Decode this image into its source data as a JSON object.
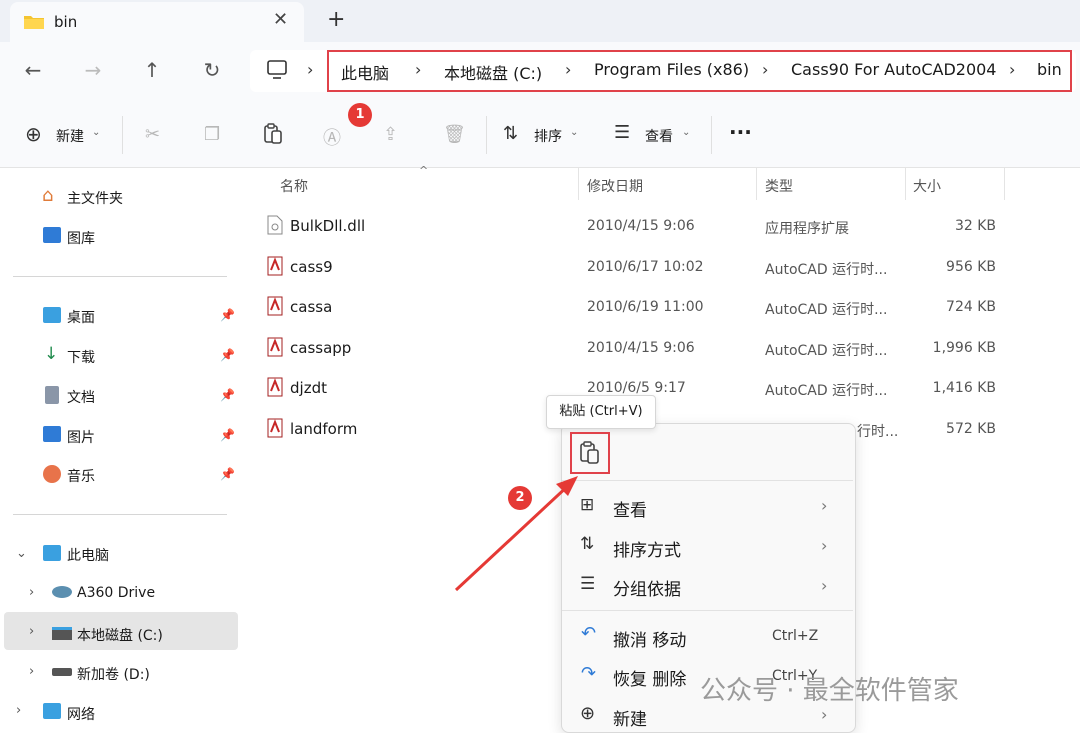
{
  "tab": {
    "title": "bin",
    "close_icon": "close-icon",
    "new_tab_icon": "plus-icon"
  },
  "nav": {
    "back": "back-arrow-icon",
    "forward": "forward-arrow-icon",
    "up": "up-arrow-icon",
    "refresh": "refresh-icon",
    "computer": "computer-icon"
  },
  "breadcrumbs": [
    "此电脑",
    "本地磁盘 (C:)",
    "Program Files (x86)",
    "Cass90 For AutoCAD2004",
    "bin"
  ],
  "toolbar": {
    "new_label": "新建",
    "sort_label": "排序",
    "view_label": "查看",
    "more": "···"
  },
  "annotations": {
    "badge1": "1",
    "badge2": "2",
    "highlight_color": "#e0424a"
  },
  "sidebar": {
    "home": "主文件夹",
    "gallery": "图库",
    "quick": [
      {
        "label": "桌面"
      },
      {
        "label": "下载"
      },
      {
        "label": "文档"
      },
      {
        "label": "图片"
      },
      {
        "label": "音乐"
      }
    ],
    "this_pc": "此电脑",
    "drives": [
      {
        "label": "A360 Drive"
      },
      {
        "label": "本地磁盘 (C:)"
      },
      {
        "label": "新加卷 (D:)"
      }
    ],
    "network": "网络"
  },
  "columns": {
    "name": "名称",
    "date": "修改日期",
    "type": "类型",
    "size": "大小"
  },
  "files": [
    {
      "name": "BulkDll.dll",
      "date": "2010/4/15 9:06",
      "type": "应用程序扩展",
      "size": "32 KB"
    },
    {
      "name": "cass9",
      "date": "2010/6/17 10:02",
      "type": "AutoCAD 运行时...",
      "size": "956 KB"
    },
    {
      "name": "cassa",
      "date": "2010/6/19 11:00",
      "type": "AutoCAD 运行时...",
      "size": "724 KB"
    },
    {
      "name": "cassapp",
      "date": "2010/4/15 9:06",
      "type": "AutoCAD 运行时...",
      "size": "1,996 KB"
    },
    {
      "name": "djzdt",
      "date": "2010/6/5 9:17",
      "type": "AutoCAD 运行时...",
      "size": "1,416 KB"
    },
    {
      "name": "landform",
      "date": "",
      "type": "行时...",
      "size": "572 KB"
    }
  ],
  "context_menu": {
    "tooltip": "粘贴 (Ctrl+V)",
    "items": [
      {
        "label": "查看",
        "shortcut": ""
      },
      {
        "label": "排序方式",
        "shortcut": ""
      },
      {
        "label": "分组依据",
        "shortcut": ""
      },
      {
        "label": "撤消 移动",
        "shortcut": "Ctrl+Z"
      },
      {
        "label": "恢复 删除",
        "shortcut": "Ctrl+Y"
      },
      {
        "label": "新建",
        "shortcut": ""
      }
    ]
  },
  "watermark": "公众号 · 最全软件管家"
}
